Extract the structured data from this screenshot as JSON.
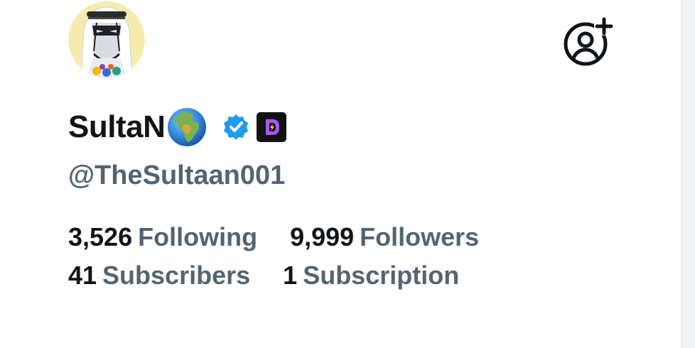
{
  "profile": {
    "display_name": "SultaN",
    "handle": "@TheSultaan001",
    "avatar_icon": "sultan-avatar",
    "name_emoji_icon": "globe-africa-europe-icon",
    "verified_icon": "verified-badge-icon",
    "app_badge_icon": "app-d-badge-icon"
  },
  "actions": {
    "follow_icon": "add-user-icon"
  },
  "stats": {
    "following_count": "3,526",
    "following_label": "Following",
    "followers_count": "9,999",
    "followers_label": "Followers",
    "subscribers_count": "41",
    "subscribers_label": "Subscribers",
    "subscriptions_count": "1",
    "subscriptions_label": "Subscription"
  },
  "colors": {
    "text_primary": "#0f1419",
    "text_secondary": "#536471",
    "verified_blue": "#1d9bf0",
    "badge_purple": "#8b3dff"
  }
}
